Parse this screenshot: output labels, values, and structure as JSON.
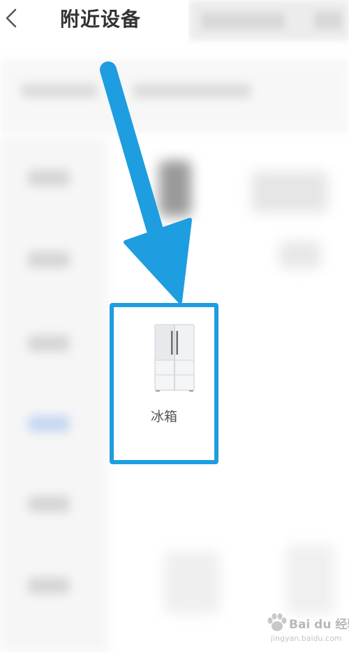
{
  "header": {
    "title": "附近设备",
    "back_icon": "chevron-left-icon"
  },
  "sidebar": {
    "active_color": "#c6d8f3"
  },
  "card": {
    "label": "冰箱",
    "icon": "refrigerator-icon",
    "highlight_color": "#1e9de1"
  },
  "annotation": {
    "arrow_color": "#1e9de1"
  },
  "watermark": {
    "brand": "Bai du 经验",
    "url": "jingyan.baidu.com"
  }
}
